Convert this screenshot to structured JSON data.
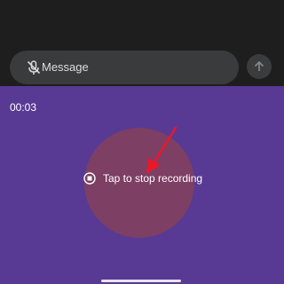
{
  "composer": {
    "placeholder": "Message",
    "mic_icon": "mic-off-icon",
    "send_icon": "arrow-up-icon"
  },
  "recording": {
    "timer": "00:03",
    "stop_label": "Tap to stop recording",
    "stop_icon": "stop-circle-icon"
  },
  "colors": {
    "panel": "#583a94",
    "tap_circle": "#7d3f64",
    "annotation_arrow": "#e8182a",
    "top_bar": "#1e1e1e"
  }
}
